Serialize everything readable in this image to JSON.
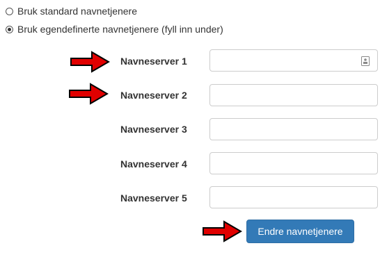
{
  "nameserver_options": {
    "standard_label": "Bruk standard navnetjenere",
    "custom_label": "Bruk egendefinerte navnetjenere (fyll inn under)",
    "selected": "custom"
  },
  "nameservers": [
    {
      "label": "Navneserver 1",
      "value": ""
    },
    {
      "label": "Navneserver 2",
      "value": ""
    },
    {
      "label": "Navneserver 3",
      "value": ""
    },
    {
      "label": "Navneserver 4",
      "value": ""
    },
    {
      "label": "Navneserver 5",
      "value": ""
    }
  ],
  "submit_button": {
    "label": "Endre navnetjenere",
    "color": "#337ab7"
  },
  "annotation_arrow_color": "#e00000"
}
